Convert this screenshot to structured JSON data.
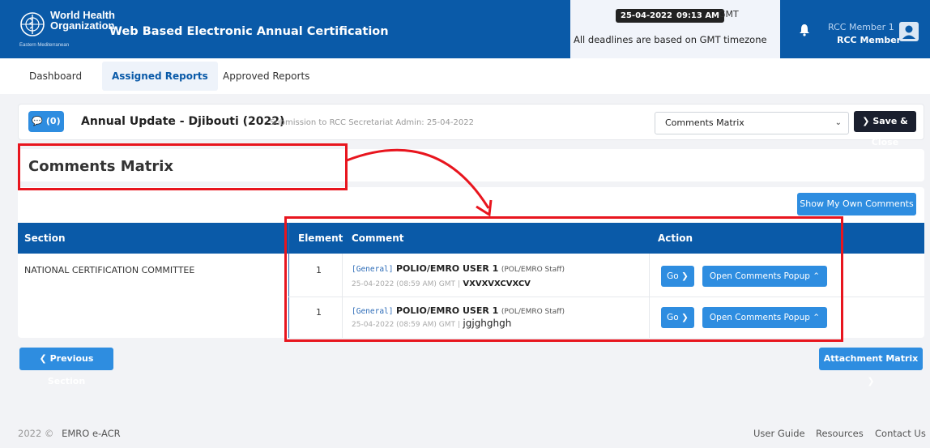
{
  "header": {
    "org_line1": "World Health",
    "org_line2": "Organization",
    "org_sub": "Eastern Mediterranean",
    "app_title": "Web Based Electronic Annual Certification",
    "date": "25-04-2022",
    "time": "09:13 AM",
    "tz": "GMT",
    "deadline_note": "All deadlines are based on GMT timezone",
    "user_name": "RCC Member 1",
    "user_role": "RCC Member"
  },
  "tabs": [
    "Dashboard",
    "Assigned Reports",
    "Approved Reports"
  ],
  "report": {
    "comment_count": "(0)",
    "title": "Annual Update - Djibouti (2022)",
    "subtitle": "Submission to RCC Secretariat Admin: 25-04-2022",
    "select_value": "Comments Matrix",
    "save_close": "Save & Close"
  },
  "matrix": {
    "title": "Comments Matrix",
    "show_own": "Show My Own Comments",
    "columns": [
      "Section",
      "Element",
      "Comment",
      "Action"
    ],
    "section": "NATIONAL CERTIFICATION COMMITTEE",
    "rows": [
      {
        "element": "1",
        "tag": "[General]",
        "user": "POLIO/EMRO USER 1",
        "role": "(POL/EMRO Staff)",
        "date": "25-04-2022 (08:59 AM) GMT |",
        "text": "VXVXVXCVXCV",
        "go": "Go",
        "popup": "Open Comments Popup"
      },
      {
        "element": "1",
        "tag": "[General]",
        "user": "POLIO/EMRO USER 1",
        "role": "(POL/EMRO Staff)",
        "date": "25-04-2022 (08:59 AM) GMT |",
        "text": "jgjghghgh",
        "go": "Go",
        "popup": "Open Comments Popup"
      }
    ]
  },
  "nav": {
    "prev": "Previous Section",
    "next": "Attachment Matrix"
  },
  "footer": {
    "copyright": "2022 ©",
    "brand": "EMRO e-ACR",
    "links": [
      "User Guide",
      "Resources",
      "Contact Us"
    ]
  },
  "colors": {
    "header_blue": "#0a5aa8",
    "button_blue": "#2e8de0",
    "annotation_red": "#e8151e"
  }
}
